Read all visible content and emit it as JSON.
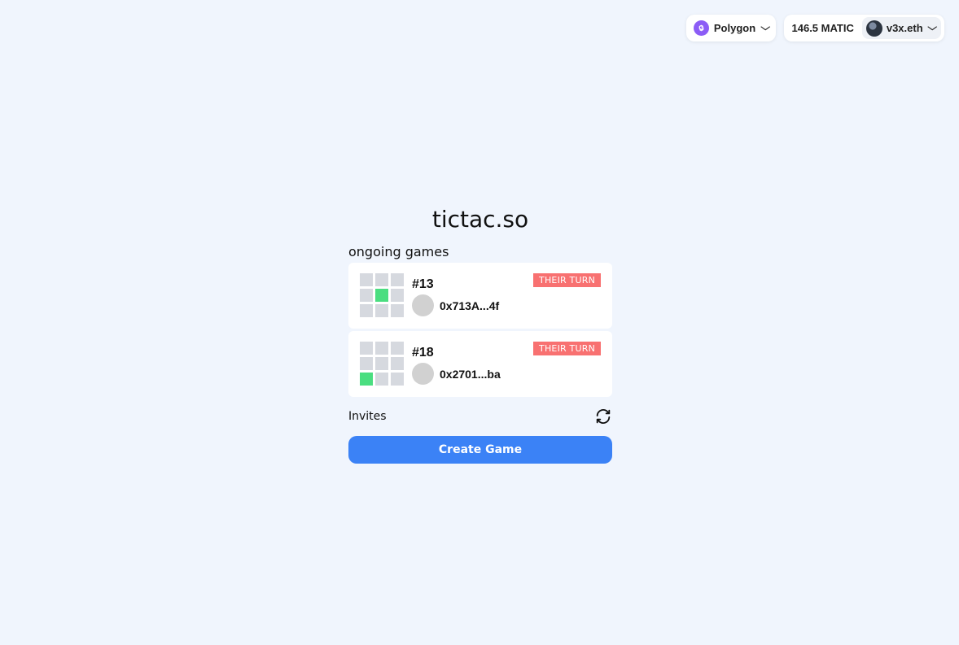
{
  "header": {
    "network": {
      "label": "Polygon",
      "icon": "polygon-logo-icon",
      "icon_color": "#8b5cf6"
    },
    "account": {
      "balance": "146.5 MATIC",
      "name": "v3x.eth"
    }
  },
  "main": {
    "title": "tictac.so",
    "ongoing_title": "ongoing games",
    "games": [
      {
        "id": "#13",
        "opponent": "0x713A...4f",
        "status": "THEIR TURN",
        "board": [
          0,
          0,
          0,
          0,
          1,
          0,
          0,
          0,
          0
        ]
      },
      {
        "id": "#18",
        "opponent": "0x2701...ba",
        "status": "THEIR TURN",
        "board": [
          0,
          0,
          0,
          0,
          0,
          0,
          1,
          0,
          0
        ]
      }
    ],
    "invites_label": "Invites",
    "create_button": "Create Game"
  },
  "colors": {
    "background": "#f0f5fd",
    "accent": "#3b82f6",
    "badge": "#f87171",
    "filled_cell": "#4ade80",
    "empty_cell": "#d6d9df"
  }
}
